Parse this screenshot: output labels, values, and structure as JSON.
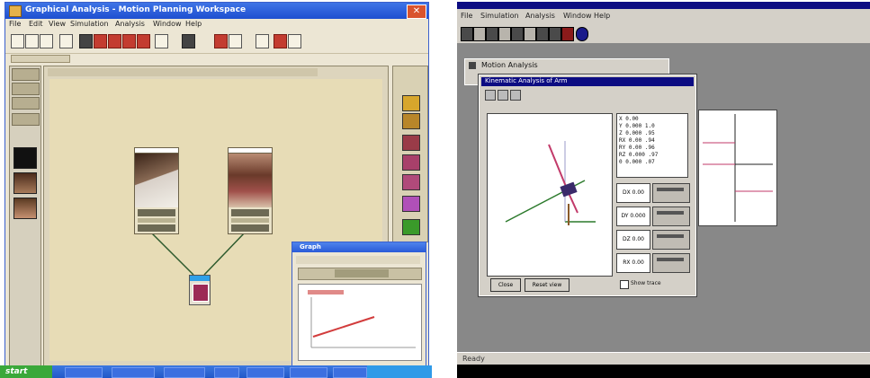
{
  "left_window": {
    "title": "Graphical Analysis - Motion Planning Workspace",
    "menu": [
      "File",
      "Edit",
      "View",
      "Simulation",
      "Analysis",
      "Window",
      "Help"
    ],
    "graph_window": {
      "title": "Graph"
    },
    "taskbar": {
      "start_label": "start"
    }
  },
  "right_window": {
    "menu": [
      "File",
      "Simulation",
      "Analysis",
      "Window",
      "Help"
    ],
    "outer_dialog_title": "Motion Analysis",
    "dialog_title": "Kinematic Analysis of Arm",
    "readout": [
      "X  0.00",
      "Y  0.000  1.0",
      "Z  0.000  .95",
      "RX 0.00  .94",
      "RY 0.00  .96",
      "RZ 0.000  .97",
      "0  0.000  .07"
    ],
    "fields": [
      "DX 0.00",
      "DY 0.000",
      "DZ 0.00",
      "RX 0.00"
    ],
    "buttons": {
      "close": "Close",
      "reset": "Reset view"
    },
    "checkbox_label": "Show trace",
    "status_text": "Ready"
  },
  "colors": {
    "xp_blue": "#1e4fd0",
    "classic_navy": "#0c0c82",
    "canvas": "#e7dcb6",
    "accent_red": "#c33c30"
  }
}
